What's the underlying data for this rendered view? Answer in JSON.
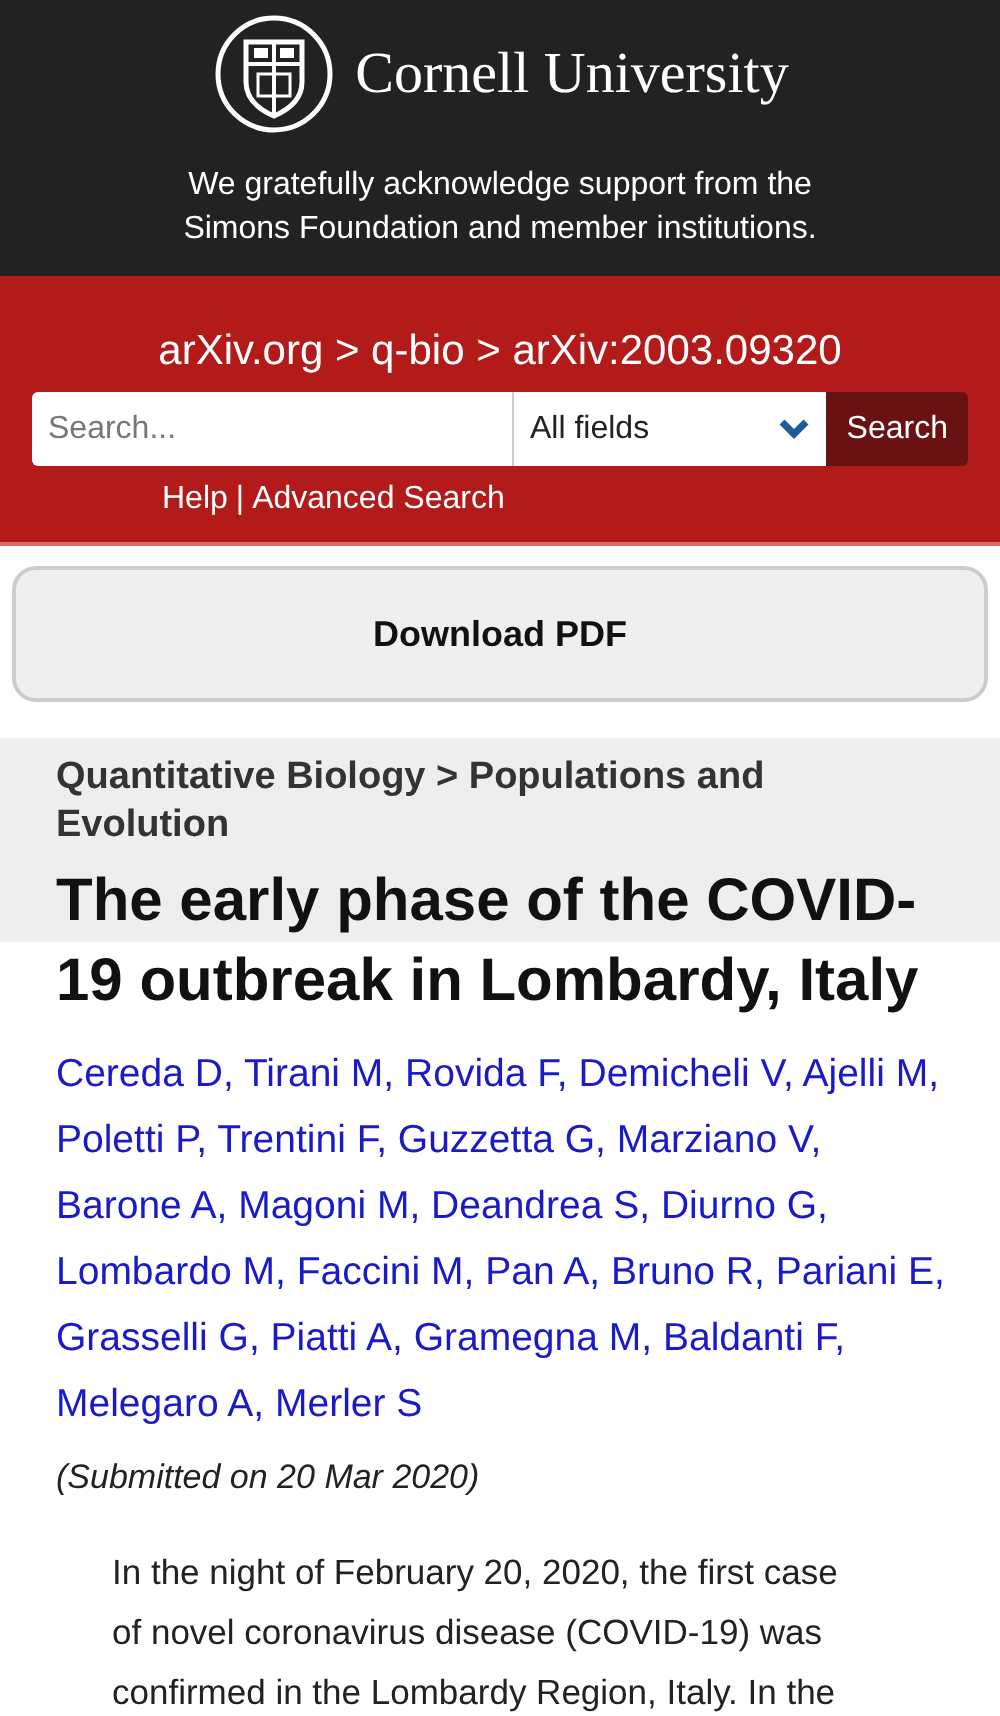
{
  "header": {
    "brand": "Cornell University",
    "support_text": "We gratefully acknowledge support from the Simons Foundation and member institutions."
  },
  "search_bar": {
    "breadcrumb": "arXiv.org > q-bio > arXiv:2003.09320",
    "placeholder": "Search...",
    "field_select": "All fields",
    "search_button": "Search",
    "help_link": "Help",
    "separator": "|",
    "advanced_link": "Advanced Search"
  },
  "download_button": "Download PDF",
  "subject": "Quantitative Biology > Populations and Evolution",
  "title": "The early phase of the COVID-19 outbreak in Lombardy, Italy",
  "author_separator": ",",
  "authors": [
    "Cereda D",
    "Tirani M",
    "Rovida F",
    "Demicheli V",
    "Ajelli M",
    "Poletti P",
    "Trentini F",
    "Guzzetta G",
    "Marziano V",
    "Barone A",
    "Magoni M",
    "Deandrea S",
    "Diurno G",
    "Lombardo M",
    "Faccini M",
    "Pan A",
    "Bruno R",
    "Pariani E",
    "Grasselli G",
    "Piatti A",
    "Gramegna M",
    "Baldanti F",
    "Melegaro A",
    "Merler S"
  ],
  "submitted": "(Submitted on 20 Mar 2020)",
  "abstract": "In the night of February 20, 2020, the first case of novel coronavirus disease (COVID-19) was confirmed in the Lombardy Region, Italy. In the"
}
